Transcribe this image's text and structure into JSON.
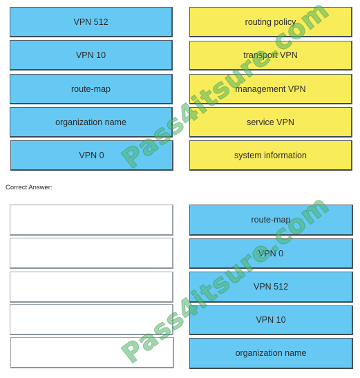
{
  "question": {
    "left_items": [
      "VPN 512",
      "VPN 10",
      "route-map",
      "organization name",
      "VPN 0"
    ],
    "right_items": [
      "routing policy",
      "transport VPN",
      "management VPN",
      "service VPN",
      "system information"
    ]
  },
  "answer": {
    "caption": "Correct Answer:",
    "left_slots": [
      "",
      "",
      "",
      "",
      ""
    ],
    "right_items": [
      "route-map",
      "VPN 0",
      "VPN 512",
      "VPN 10",
      "organization name"
    ]
  },
  "watermark": {
    "text": "Pass4itsure.com"
  },
  "colors": {
    "draggable_blue": "#66c9f4",
    "target_yellow": "#f9ec5a",
    "watermark_green": "#4fb867"
  }
}
